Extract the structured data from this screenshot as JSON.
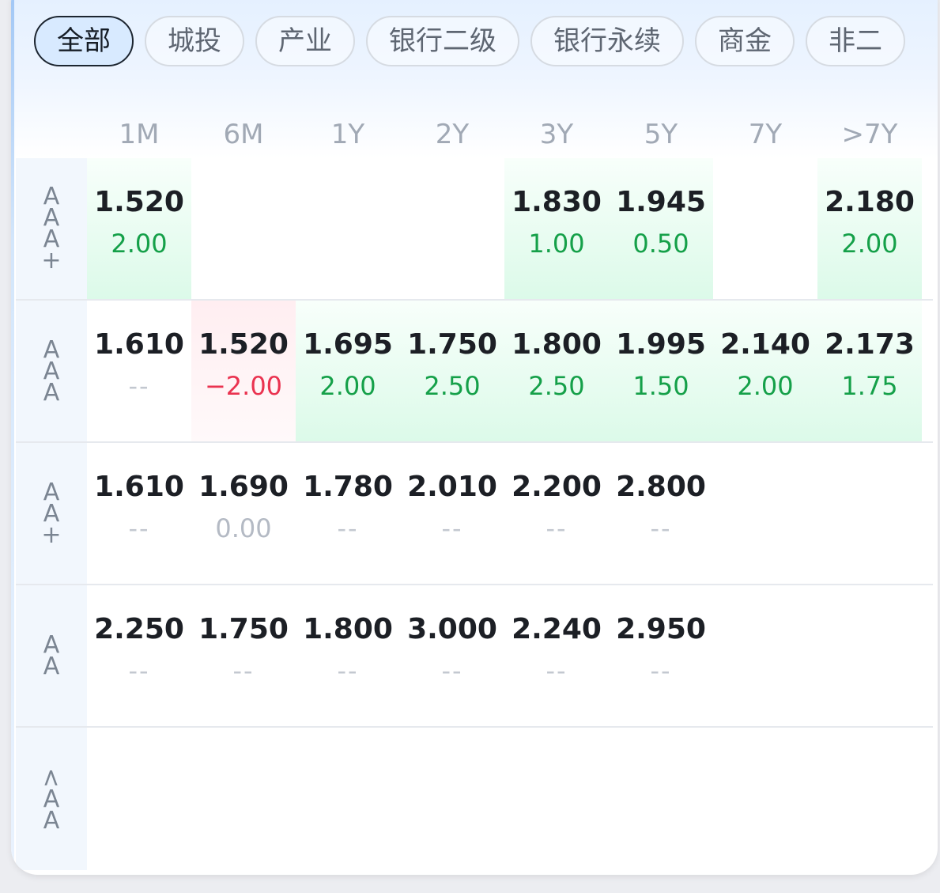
{
  "tabs": [
    {
      "label": "全部",
      "active": true
    },
    {
      "label": "城投",
      "active": false
    },
    {
      "label": "产业",
      "active": false
    },
    {
      "label": "银行二级",
      "active": false
    },
    {
      "label": "银行永续",
      "active": false
    },
    {
      "label": "商金",
      "active": false
    },
    {
      "label": "非二",
      "active": false
    }
  ],
  "columns": [
    "1M",
    "6M",
    "1Y",
    "2Y",
    "3Y",
    "5Y",
    "7Y",
    ">7Y"
  ],
  "rows": [
    {
      "rating": "AAA+",
      "cells": [
        {
          "rate": "1.520",
          "change": "2.00",
          "trend": "up"
        },
        {
          "rate": "",
          "change": "",
          "trend": "none"
        },
        {
          "rate": "",
          "change": "",
          "trend": "none"
        },
        {
          "rate": "",
          "change": "",
          "trend": "none"
        },
        {
          "rate": "1.830",
          "change": "1.00",
          "trend": "up"
        },
        {
          "rate": "1.945",
          "change": "0.50",
          "trend": "up"
        },
        {
          "rate": "",
          "change": "",
          "trend": "none"
        },
        {
          "rate": "2.180",
          "change": "2.00",
          "trend": "up"
        }
      ]
    },
    {
      "rating": "AAA",
      "cells": [
        {
          "rate": "1.610",
          "change": "--",
          "trend": "dash"
        },
        {
          "rate": "1.520",
          "change": "−2.00",
          "trend": "down"
        },
        {
          "rate": "1.695",
          "change": "2.00",
          "trend": "up"
        },
        {
          "rate": "1.750",
          "change": "2.50",
          "trend": "up"
        },
        {
          "rate": "1.800",
          "change": "2.50",
          "trend": "up"
        },
        {
          "rate": "1.995",
          "change": "1.50",
          "trend": "up"
        },
        {
          "rate": "2.140",
          "change": "2.00",
          "trend": "up"
        },
        {
          "rate": "2.173",
          "change": "1.75",
          "trend": "up"
        }
      ]
    },
    {
      "rating": "AA+",
      "cells": [
        {
          "rate": "1.610",
          "change": "--",
          "trend": "dash"
        },
        {
          "rate": "1.690",
          "change": "0.00",
          "trend": "flat"
        },
        {
          "rate": "1.780",
          "change": "--",
          "trend": "dash"
        },
        {
          "rate": "2.010",
          "change": "--",
          "trend": "dash"
        },
        {
          "rate": "2.200",
          "change": "--",
          "trend": "dash"
        },
        {
          "rate": "2.800",
          "change": "--",
          "trend": "dash"
        },
        {
          "rate": "",
          "change": "",
          "trend": "none"
        },
        {
          "rate": "",
          "change": "",
          "trend": "none"
        }
      ]
    },
    {
      "rating": "AA",
      "cells": [
        {
          "rate": "2.250",
          "change": "--",
          "trend": "dash"
        },
        {
          "rate": "1.750",
          "change": "--",
          "trend": "dash"
        },
        {
          "rate": "1.800",
          "change": "--",
          "trend": "dash"
        },
        {
          "rate": "3.000",
          "change": "--",
          "trend": "dash"
        },
        {
          "rate": "2.240",
          "change": "--",
          "trend": "dash"
        },
        {
          "rate": "2.950",
          "change": "--",
          "trend": "dash"
        },
        {
          "rate": "",
          "change": "",
          "trend": "none"
        },
        {
          "rate": "",
          "change": "",
          "trend": "none"
        }
      ]
    },
    {
      "rating": "<AA",
      "cells": [
        {
          "rate": "",
          "change": "",
          "trend": "none"
        },
        {
          "rate": "",
          "change": "",
          "trend": "none"
        },
        {
          "rate": "",
          "change": "",
          "trend": "none"
        },
        {
          "rate": "",
          "change": "",
          "trend": "none"
        },
        {
          "rate": "",
          "change": "",
          "trend": "none"
        },
        {
          "rate": "",
          "change": "",
          "trend": "none"
        },
        {
          "rate": "",
          "change": "",
          "trend": "none"
        },
        {
          "rate": "",
          "change": "",
          "trend": "none"
        }
      ]
    }
  ],
  "colors": {
    "up": "#15a049",
    "down": "#ea3350",
    "up_bg": "#dcfae9",
    "down_bg": "#ffeef1",
    "active_tab_bg": "#d8eaff"
  }
}
